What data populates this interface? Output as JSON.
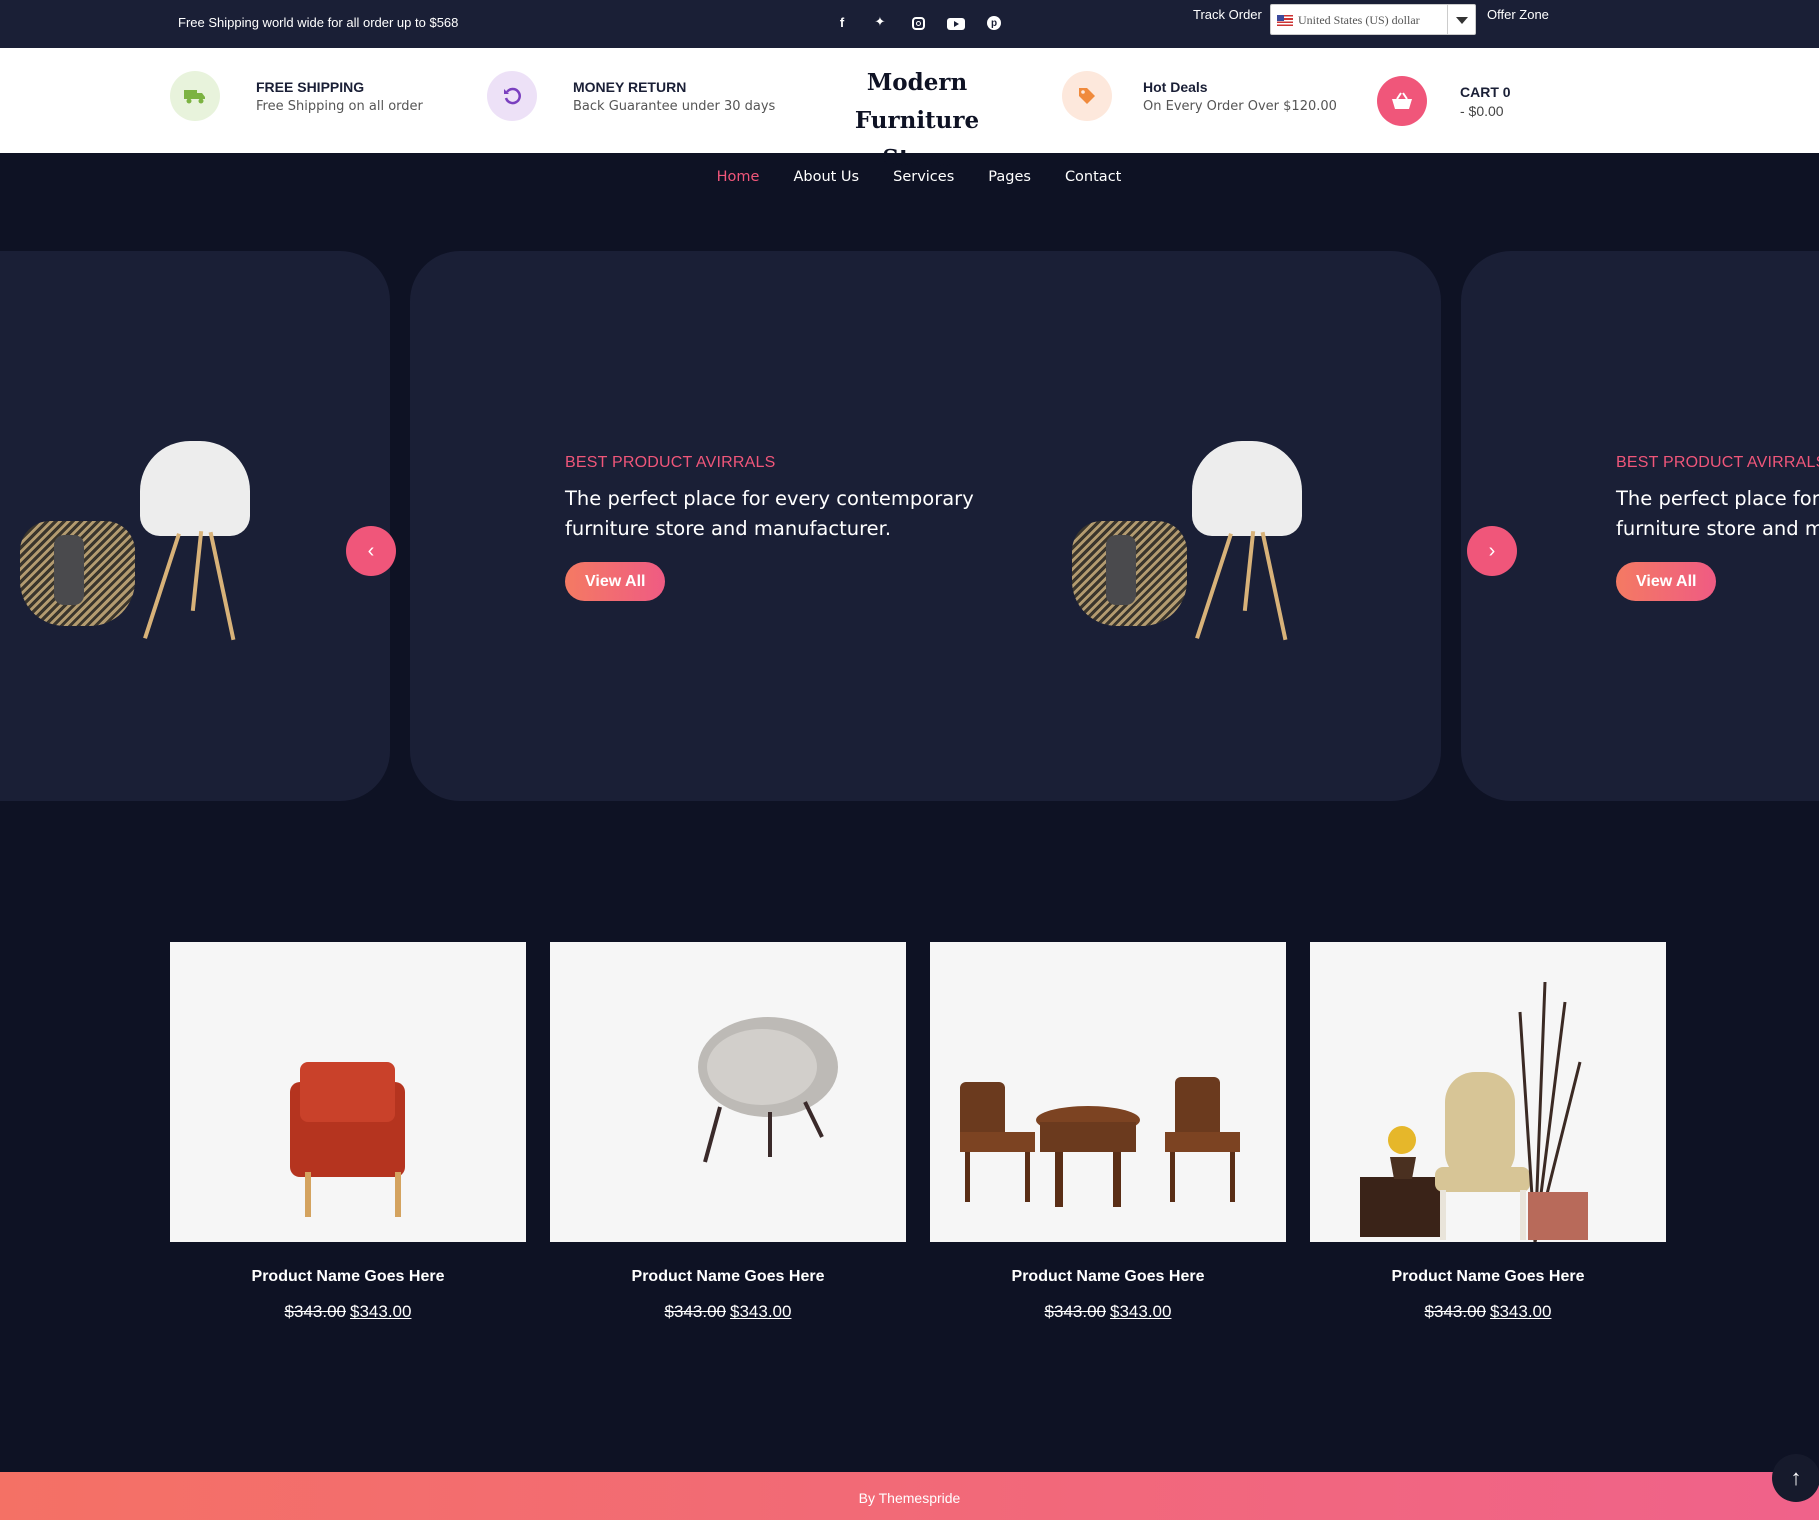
{
  "topbar": {
    "shipping_text": "Free Shipping world wide for all order up to $568",
    "socials": [
      "facebook-icon",
      "twitter-icon",
      "instagram-icon",
      "youtube-icon",
      "pinterest-icon"
    ],
    "track_order": "Track Order",
    "currency_selected": "United States (US) dollar",
    "offer_zone": "Offer Zone"
  },
  "header": {
    "features": [
      {
        "title": "FREE SHIPPING",
        "subtitle": "Free Shipping on all order",
        "icon": "truck-icon"
      },
      {
        "title": "MONEY RETURN",
        "subtitle": "Back Guarantee under 30 days",
        "icon": "undo-icon"
      },
      {
        "title": "Hot Deals",
        "subtitle": "On Every Order Over $120.00",
        "icon": "tag-icon"
      }
    ],
    "brand_line1": "Modern",
    "brand_line2": "Furniture Store",
    "cart": {
      "label": "CART 0",
      "total": "- $0.00",
      "icon": "basket-icon"
    }
  },
  "nav": {
    "items": [
      "Home",
      "About Us",
      "Services",
      "Pages",
      "Contact"
    ],
    "active": "Home"
  },
  "hero": {
    "subtitle": "BEST PRODUCT AVIRRALS",
    "title": "The perfect place for every contemporary furniture store and manufacturer.",
    "button": "View All",
    "prev": "‹",
    "next": "›"
  },
  "products": [
    {
      "name": "Product Name Goes Here",
      "old_price": "$343.00",
      "price": "$343.00"
    },
    {
      "name": "Product Name Goes Here",
      "old_price": "$343.00",
      "price": "$343.00"
    },
    {
      "name": "Product Name Goes Here",
      "old_price": "$343.00",
      "price": "$343.00"
    },
    {
      "name": "Product Name Goes Here",
      "old_price": "$343.00",
      "price": "$343.00"
    }
  ],
  "footer": {
    "credit": "By Themespride",
    "back_to_top": "↑"
  },
  "colors": {
    "accent": "#f0567a",
    "dark": "#0e1224",
    "panel": "#1a1f36"
  }
}
